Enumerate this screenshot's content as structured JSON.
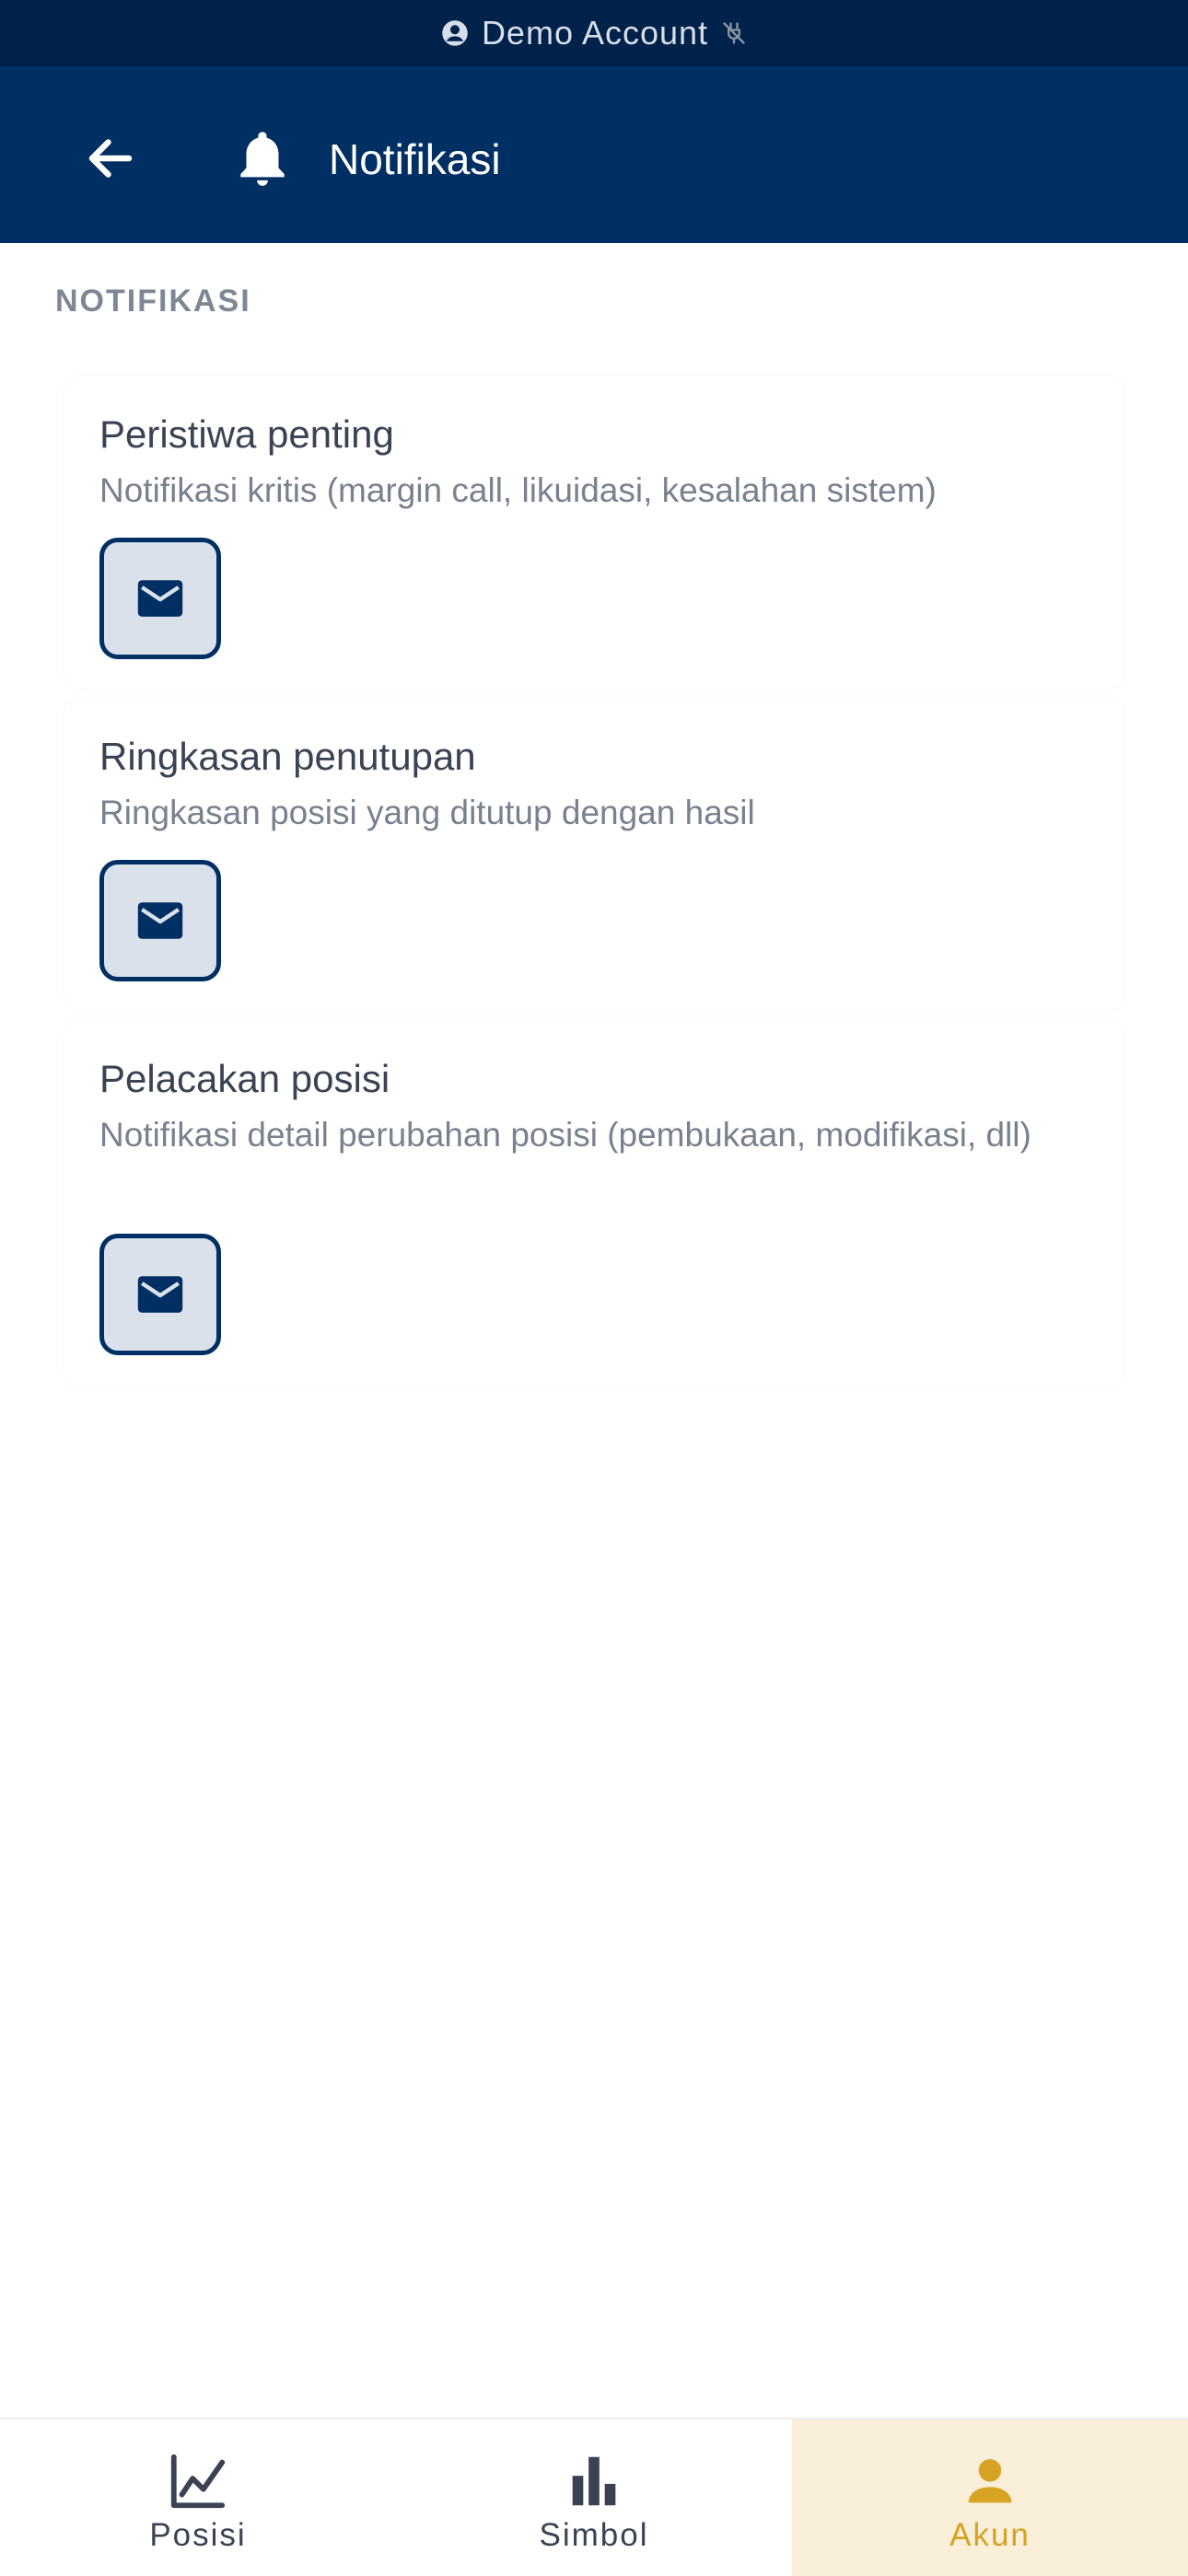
{
  "status_bar": {
    "text": "Demo Account",
    "person_icon": "person-circle-icon",
    "plug_icon": "plug-off-icon"
  },
  "header": {
    "title": "Notifikasi",
    "back_icon": "arrow-left-icon",
    "bell_icon": "bell-icon"
  },
  "section": {
    "label": "NOTIFIKASI"
  },
  "cards": [
    {
      "title": "Peristiwa penting",
      "description": "Notifikasi kritis (margin call, likuidasi, kesalahan sistem)",
      "toggle_icon": "mail-icon"
    },
    {
      "title": "Ringkasan penutupan",
      "description": "Ringkasan posisi yang ditutup dengan hasil",
      "toggle_icon": "mail-icon"
    },
    {
      "title": "Pelacakan posisi",
      "description": "Notifikasi detail perubahan posisi (pembukaan, modifikasi, dll)",
      "toggle_icon": "mail-icon"
    }
  ],
  "bottom_nav": {
    "items": [
      {
        "label": "Posisi",
        "icon": "line-chart-icon",
        "active": false
      },
      {
        "label": "Simbol",
        "icon": "bar-chart-icon",
        "active": false
      },
      {
        "label": "Akun",
        "icon": "person-icon",
        "active": true
      }
    ]
  },
  "colors": {
    "status_bar_bg": "#00214a",
    "header_bg": "#002f63",
    "accent": "#d6a322",
    "active_nav_bg": "#faefd9",
    "toggle_bg": "#dae1ea"
  }
}
